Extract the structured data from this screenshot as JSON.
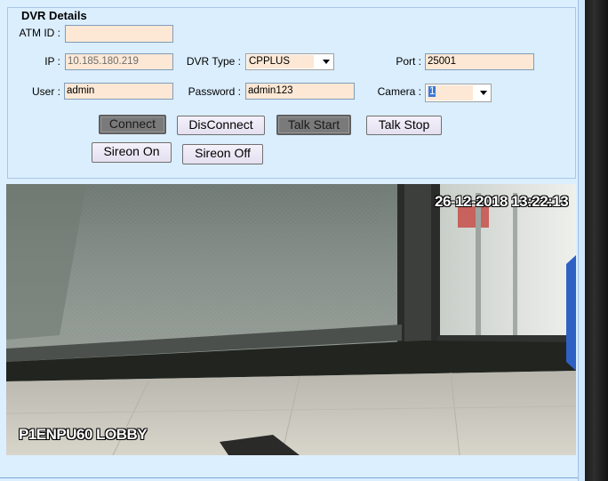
{
  "dvr": {
    "title": "DVR Details",
    "atm_id": {
      "label": "ATM ID :",
      "value": ""
    },
    "ip": {
      "label": "IP :",
      "value": "10.185.180.219"
    },
    "dvr_type": {
      "label": "DVR Type :",
      "value": "CPPLUS"
    },
    "port": {
      "label": "Port :",
      "value": "25001"
    },
    "user": {
      "label": "User :",
      "value": "admin"
    },
    "password": {
      "label": "Password :",
      "value": "admin123"
    },
    "camera": {
      "label": "Camera :",
      "value": "1"
    }
  },
  "buttons": {
    "connect": "Connect",
    "disconnect": "DisConnect",
    "talk_start": "Talk Start",
    "talk_stop": "Talk Stop",
    "sireon_on": "Sireon On",
    "sireon_off": "Sireon Off"
  },
  "video": {
    "timestamp": "26-12-2018 13:22:13",
    "camera_name": "P1ENPU60 LOBBY"
  },
  "colors": {
    "panel_background": "#dbeefe",
    "input_background": "#fde8d5",
    "pressed_button": "#7a7a7a"
  }
}
